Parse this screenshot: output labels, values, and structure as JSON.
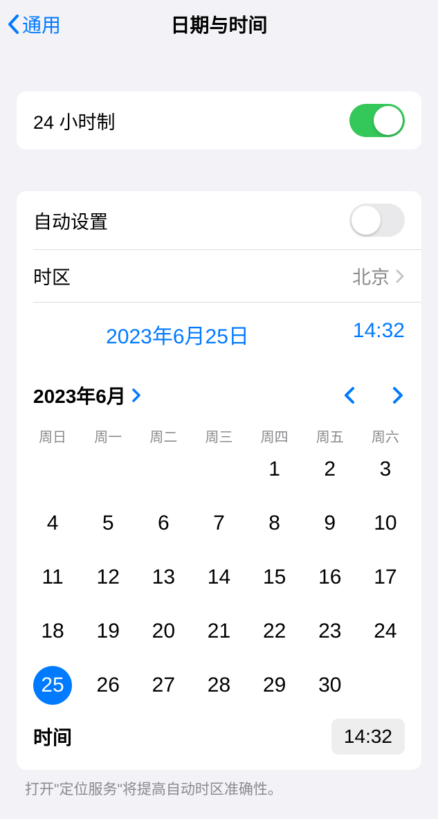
{
  "nav": {
    "back_label": "通用",
    "title": "日期与时间"
  },
  "section1": {
    "hour24_label": "24 小时制"
  },
  "section2": {
    "auto_label": "自动设置",
    "timezone_label": "时区",
    "timezone_value": "北京",
    "date_display": "2023年6月25日",
    "time_display": "14:32",
    "month_label": "2023年6月",
    "weekdays": [
      "周日",
      "周一",
      "周二",
      "周三",
      "周四",
      "周五",
      "周六"
    ],
    "calendar": {
      "leading_blanks": 4,
      "days": [
        1,
        2,
        3,
        4,
        5,
        6,
        7,
        8,
        9,
        10,
        11,
        12,
        13,
        14,
        15,
        16,
        17,
        18,
        19,
        20,
        21,
        22,
        23,
        24,
        25,
        26,
        27,
        28,
        29,
        30
      ],
      "selected": 25
    },
    "time_label": "时间",
    "time_value": "14:32"
  },
  "footnote": "打开\"定位服务\"将提高自动时区准确性。"
}
